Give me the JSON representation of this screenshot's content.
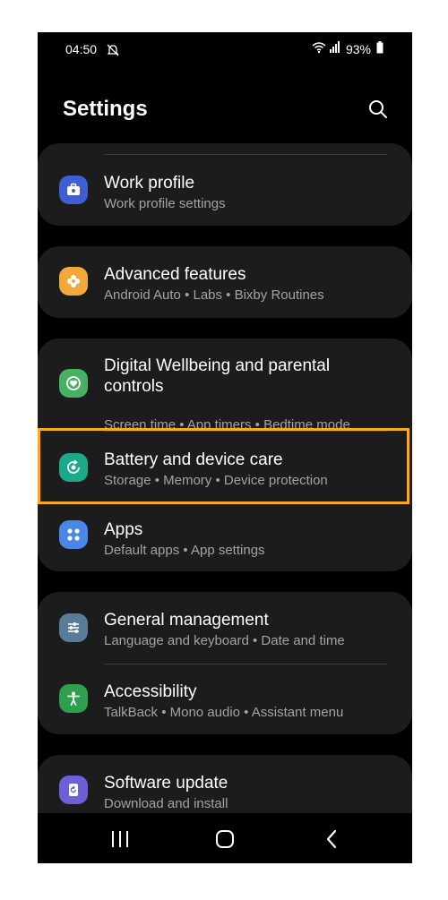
{
  "status_bar": {
    "time": "04:50",
    "battery": "93%"
  },
  "header": {
    "title": "Settings"
  },
  "items": [
    {
      "label": "Work profile",
      "sub": "Work profile settings",
      "color": "#3f5fd1"
    },
    {
      "label": "Advanced features",
      "sub": "Android Auto  •  Labs  •  Bixby Routines",
      "color": "#f0a93a"
    },
    {
      "label": "Digital Wellbeing and parental controls",
      "sub": "Screen time  •  App timers  •  Bedtime mode",
      "color": "#47b064"
    },
    {
      "label": "Battery and device care",
      "sub": "Storage  •  Memory  •  Device protection",
      "color": "#1aa98a"
    },
    {
      "label": "Apps",
      "sub": "Default apps  •  App settings",
      "color": "#4a86e8"
    },
    {
      "label": "General management",
      "sub": "Language and keyboard  •  Date and time",
      "color": "#5a7b98"
    },
    {
      "label": "Accessibility",
      "sub": "TalkBack  •  Mono audio  •  Assistant menu",
      "color": "#2f9e4f"
    },
    {
      "label": "Software update",
      "sub": "Download and install",
      "color": "#6d5fd7"
    }
  ],
  "highlight_color": "#f6ad1b"
}
